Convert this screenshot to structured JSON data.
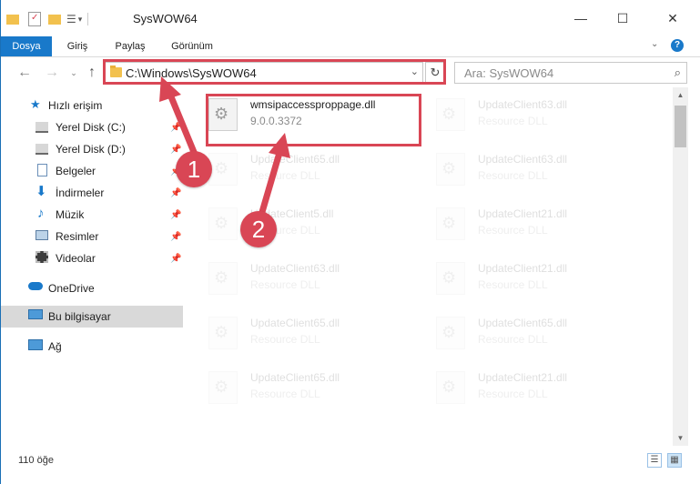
{
  "window": {
    "title": "SysWOW64",
    "controls": {
      "minimize": "—",
      "maximize": "☐",
      "close": "✕"
    }
  },
  "ribbon": {
    "tabs": [
      "Dosya",
      "Giriş",
      "Paylaş",
      "Görünüm"
    ]
  },
  "address": {
    "path": "C:\\Windows\\SysWOW64",
    "search_placeholder": "Ara: SysWOW64"
  },
  "sidebar": {
    "quick_access": "Hızlı erişim",
    "items": [
      {
        "label": "Yerel Disk (C:)",
        "pinned": true
      },
      {
        "label": "Yerel Disk (D:)",
        "pinned": true
      },
      {
        "label": "Belgeler",
        "pinned": true
      },
      {
        "label": "İndirmeler",
        "pinned": true
      },
      {
        "label": "Müzik",
        "pinned": true
      },
      {
        "label": "Resimler",
        "pinned": true
      },
      {
        "label": "Videolar",
        "pinned": true
      }
    ],
    "onedrive": "OneDrive",
    "this_pc": "Bu bilgisayar",
    "network": "Ağ"
  },
  "files": [
    {
      "name": "wmsipaccessproppage.dll",
      "sub": "9.0.0.3372",
      "faded": false
    },
    {
      "name": "UpdateClient63.dll",
      "sub": "Resource DLL",
      "faded": true
    },
    {
      "name": "UpdateClient65.dll",
      "sub": "Resource DLL",
      "faded": true
    },
    {
      "name": "UpdateClient63.dll",
      "sub": "Resource DLL",
      "faded": true
    },
    {
      "name": "UpdateClient5.dll",
      "sub": "Resource DLL",
      "faded": true
    },
    {
      "name": "UpdateClient21.dll",
      "sub": "Resource DLL",
      "faded": true
    },
    {
      "name": "UpdateClient63.dll",
      "sub": "Resource DLL",
      "faded": true
    },
    {
      "name": "UpdateClient21.dll",
      "sub": "Resource DLL",
      "faded": true
    },
    {
      "name": "UpdateClient65.dll",
      "sub": "Resource DLL",
      "faded": true
    },
    {
      "name": "UpdateClient65.dll",
      "sub": "Resource DLL",
      "faded": true
    },
    {
      "name": "UpdateClient65.dll",
      "sub": "Resource DLL",
      "faded": true
    },
    {
      "name": "UpdateClient21.dll",
      "sub": "Resource DLL",
      "faded": true
    }
  ],
  "status": {
    "count": "110 öğe"
  },
  "annotations": {
    "step1": "1",
    "step2": "2",
    "color": "#d94655"
  },
  "colors": {
    "accent": "#1979ca",
    "highlight": "#d94655"
  }
}
